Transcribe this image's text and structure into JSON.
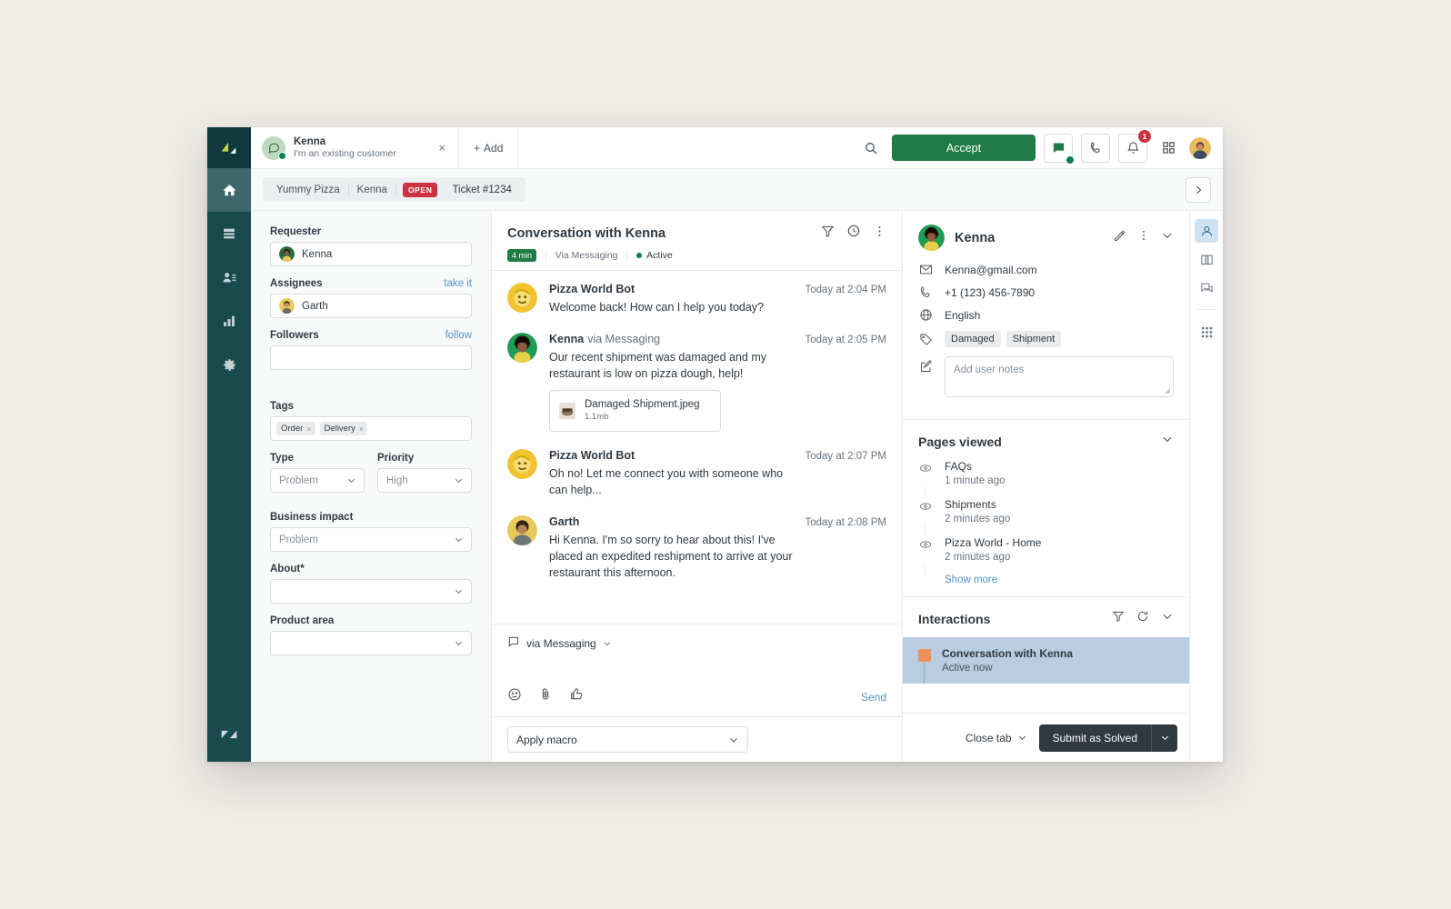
{
  "nav_rail": {
    "logo": "zendesk-logo",
    "items": [
      {
        "name": "home",
        "icon": "home-icon",
        "active": true
      },
      {
        "name": "views",
        "icon": "views-icon",
        "active": false
      },
      {
        "name": "customers",
        "icon": "customers-icon",
        "active": false
      },
      {
        "name": "reporting",
        "icon": "reporting-icon",
        "active": false
      },
      {
        "name": "admin",
        "icon": "gear-icon",
        "active": false
      }
    ],
    "bottom_icon": "zendesk-mark"
  },
  "tabstrip": {
    "tab": {
      "title": "Kenna",
      "subtitle": "I'm an existing customer",
      "close_label": "×",
      "status": "online"
    },
    "add_label": "Add",
    "add_plus": "+",
    "tools": {
      "search_icon": "search-icon",
      "accept_label": "Accept",
      "chat_icon": "chat-icon",
      "call_icon": "phone-icon",
      "bell_icon": "bell-icon",
      "bell_badge": "1",
      "apps_icon": "apps-grid-icon",
      "avatar": "agent-avatar"
    }
  },
  "breadcrumb": {
    "org": "Yummy Pizza",
    "requester": "Kenna",
    "status_pill": "OPEN",
    "ticket": "Ticket #1234",
    "expand_icon": "chevron-right-icon"
  },
  "ticket_form": {
    "requester": {
      "label": "Requester",
      "value": "Kenna"
    },
    "assignees": {
      "label": "Assignees",
      "action": "take it",
      "value": "Garth"
    },
    "followers": {
      "label": "Followers",
      "action": "follow",
      "value": ""
    },
    "tags": {
      "label": "Tags",
      "chips": [
        "Order",
        "Delivery"
      ],
      "remove_glyph": "×"
    },
    "type": {
      "label": "Type",
      "value": "Problem"
    },
    "priority": {
      "label": "Priority",
      "value": "High"
    },
    "business_impact": {
      "label": "Business impact",
      "value": "Problem"
    },
    "about": {
      "label": "About*",
      "value": ""
    },
    "product_area": {
      "label": "Product area",
      "value": ""
    }
  },
  "conversation": {
    "title": "Conversation with Kenna",
    "duration_chip": "4 min",
    "channel": "Via Messaging",
    "status": "Active",
    "icons": {
      "filter": "filter-icon",
      "history": "history-icon",
      "more": "more-vertical-icon"
    },
    "messages": [
      {
        "author": "Pizza World Bot",
        "via": "",
        "time": "Today at 2:04 PM",
        "text": "Welcome back! How can I help you today?",
        "avatar": "bot-avatar",
        "attachment": null
      },
      {
        "author": "Kenna",
        "via": "via Messaging",
        "time": "Today at 2:05 PM",
        "text": "Our recent shipment was damaged and my restaurant is low on pizza dough, help!",
        "avatar": "kenna-avatar",
        "attachment": {
          "name": "Damaged Shipment.jpeg",
          "size": "1.1mb"
        }
      },
      {
        "author": "Pizza World Bot",
        "via": "",
        "time": "Today at 2:07 PM",
        "text": "Oh no! Let me connect you with someone who can help...",
        "avatar": "bot-avatar",
        "attachment": null
      },
      {
        "author": "Garth",
        "via": "",
        "time": "Today at 2:08 PM",
        "text": "Hi Kenna. I'm so sorry to hear about this! I've placed an expedited reshipment to arrive at your restaurant this afternoon.",
        "avatar": "garth-avatar",
        "attachment": null
      }
    ]
  },
  "composer": {
    "channel_label": "via Messaging",
    "channel_icon": "comment-icon",
    "placeholder": "",
    "tools": [
      {
        "name": "emoji-icon",
        "glyph": "☺"
      },
      {
        "name": "attachment-icon",
        "glyph": "📎"
      },
      {
        "name": "thumbs-up-icon",
        "glyph": "👍"
      }
    ],
    "send_label": "Send",
    "macro_placeholder": "Apply macro"
  },
  "customer": {
    "name": "Kenna",
    "edit_icon": "pencil-icon",
    "more_icon": "more-vertical-icon",
    "collapse_icon": "chevron-down-icon",
    "email": "Kenna@gmail.com",
    "phone": "+1 (123) 456-7890",
    "language": "English",
    "tags": [
      "Damaged",
      "Shipment"
    ],
    "notes_placeholder": "Add user notes"
  },
  "pages_viewed": {
    "title": "Pages viewed",
    "collapse_icon": "chevron-down-icon",
    "items": [
      {
        "name": "FAQs",
        "time": "1 minute ago"
      },
      {
        "name": "Shipments",
        "time": "2 minutes ago"
      },
      {
        "name": "Pizza World - Home",
        "time": "2 minutes ago"
      }
    ],
    "show_more": "Show more"
  },
  "interactions": {
    "title": "Interactions",
    "filter_icon": "filter-icon",
    "refresh_icon": "refresh-icon",
    "collapse_icon": "chevron-down-icon",
    "items": [
      {
        "title": "Conversation with Kenna",
        "subtitle": "Active now",
        "color": "#ed8f5b"
      }
    ]
  },
  "action_bar": {
    "close_tab": "Close tab",
    "close_tab_caret": "chevron-down-icon",
    "submit_label": "Submit as Solved",
    "submit_caret": "chevron-down-icon"
  },
  "app_rail": {
    "items": [
      {
        "name": "user-panel-icon",
        "active": true
      },
      {
        "name": "knowledge-icon",
        "active": false
      },
      {
        "name": "conversations-icon",
        "active": false
      },
      {
        "name": "apps-grid-icon",
        "active": false
      }
    ]
  },
  "colors": {
    "nav_bg": "#17494d",
    "accent_green": "#1f7c44",
    "status_red": "#cc3340",
    "link_blue": "#5293c7",
    "interaction_bg": "#b8cde0",
    "interaction_marker": "#ed8f5b",
    "submit_dark": "#2f3941"
  }
}
